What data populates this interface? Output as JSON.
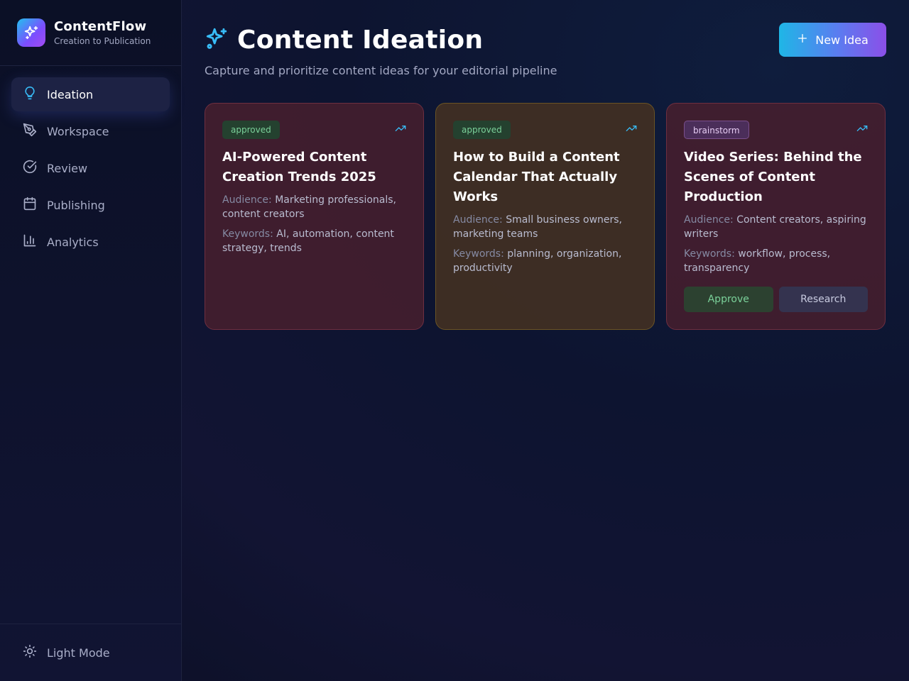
{
  "brand": {
    "name": "ContentFlow",
    "tagline": "Creation to Publication",
    "logo_icon": "sparkles-icon"
  },
  "sidebar": {
    "items": [
      {
        "label": "Ideation",
        "icon": "lightbulb-icon",
        "active": true
      },
      {
        "label": "Workspace",
        "icon": "pen-tool-icon",
        "active": false
      },
      {
        "label": "Review",
        "icon": "check-circle-icon",
        "active": false
      },
      {
        "label": "Publishing",
        "icon": "calendar-icon",
        "active": false
      },
      {
        "label": "Analytics",
        "icon": "bar-chart-icon",
        "active": false
      }
    ],
    "theme_toggle": {
      "label": "Light Mode",
      "icon": "sun-icon"
    }
  },
  "header": {
    "title": "Content Ideation",
    "subtitle": "Capture and prioritize content ideas for your editorial pipeline",
    "new_button_label": "New Idea"
  },
  "colors": {
    "accent_cyan": "#22c1ee",
    "accent_purple": "#8b4fe8",
    "approved_green": "#7bd19a",
    "brainstorm_purple": "#e7cdf4"
  },
  "ideas": [
    {
      "status": "approved",
      "title": "AI-Powered Content Creation Trends 2025",
      "audience_label": "Audience:",
      "audience": "Marketing professionals, content creators",
      "keywords_label": "Keywords:",
      "keywords": "AI, automation, content strategy, trends",
      "trend_icon": "trending-up-icon"
    },
    {
      "status": "approved",
      "title": "How to Build a Content Calendar That Actually Works",
      "audience_label": "Audience:",
      "audience": "Small business owners, marketing teams",
      "keywords_label": "Keywords:",
      "keywords": "planning, organization, productivity",
      "trend_icon": "trending-up-icon"
    },
    {
      "status": "brainstorm",
      "title": "Video Series: Behind the Scenes of Content Production",
      "audience_label": "Audience:",
      "audience": "Content creators, aspiring writers",
      "keywords_label": "Keywords:",
      "keywords": "workflow, process, transparency",
      "trend_icon": "trending-up-icon",
      "approve_label": "Approve",
      "research_label": "Research"
    }
  ]
}
